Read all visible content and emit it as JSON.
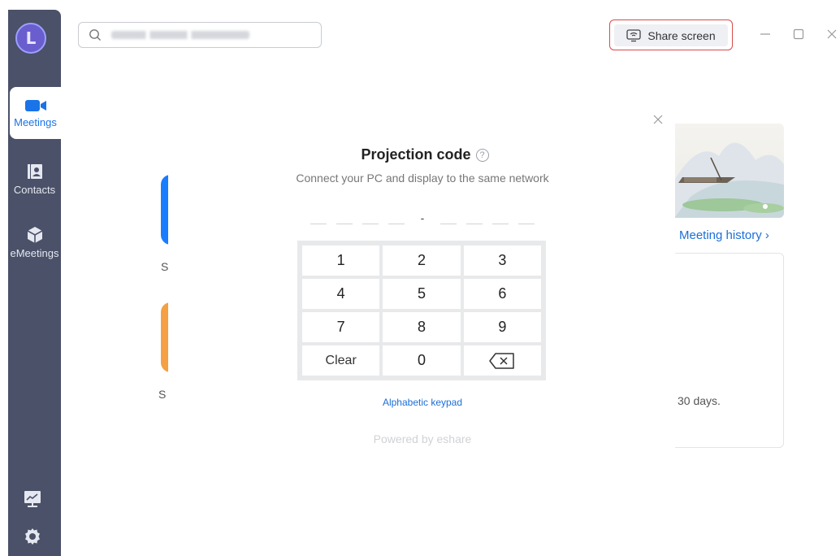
{
  "sidebar": {
    "avatar_letter": "L",
    "items": [
      {
        "label": "Meetings",
        "icon": "video-camera-icon"
      },
      {
        "label": "Contacts",
        "icon": "contacts-book-icon"
      },
      {
        "label": "eMeetings",
        "icon": "cube-icon"
      }
    ],
    "bottom_icons": [
      "whiteboard-chart-icon",
      "settings-gear-icon"
    ]
  },
  "toolbar": {
    "search_icon": "search-icon",
    "share_screen_label": "Share screen",
    "window_controls": [
      "minimize",
      "maximize",
      "close"
    ]
  },
  "background": {
    "card_fragment_1": "S",
    "card_fragment_2": "S",
    "meeting_history_label": "Meeting history",
    "history_note_fragment": "30 days."
  },
  "dialog": {
    "title": "Projection code",
    "subtitle": "Connect your PC and display to the same network",
    "code_separator": "-",
    "keys": [
      "1",
      "2",
      "3",
      "4",
      "5",
      "6",
      "7",
      "8",
      "9",
      "Clear",
      "0",
      "⌫"
    ],
    "alphabetic_keypad_label": "Alphabetic keypad",
    "powered_by": "Powered by eshare"
  },
  "colors": {
    "sidebar_bg": "#4a5168",
    "accent_blue": "#1a73e8",
    "share_outline_red": "#d94a4a",
    "card_blue": "#1a7cff",
    "card_orange": "#f4a043"
  }
}
